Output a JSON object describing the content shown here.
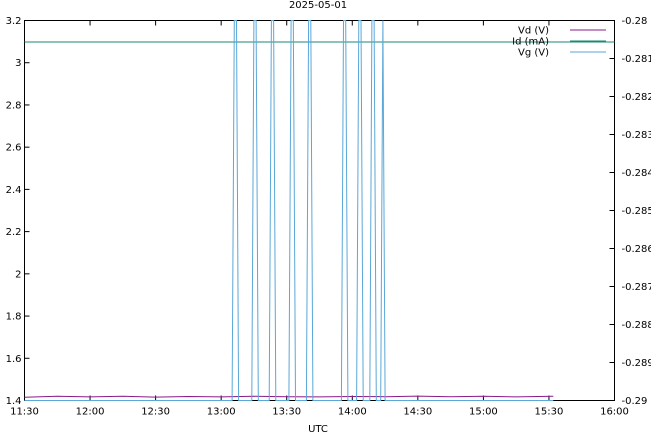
{
  "chart_data": {
    "type": "line",
    "title": "2025-05-01",
    "xlabel": "UTC",
    "ylabel": "",
    "y2label": "",
    "grid": false,
    "legend_position": "top-right",
    "x_ticks": [
      "11:30",
      "12:00",
      "12:30",
      "13:00",
      "13:30",
      "14:00",
      "14:30",
      "15:00",
      "15:30",
      "16:00"
    ],
    "xlim": [
      "11:30",
      "16:00"
    ],
    "ylim": [
      1.4,
      3.2
    ],
    "y_ticks": [
      "1.4",
      "1.6",
      "1.8",
      "2",
      "2.2",
      "2.4",
      "2.6",
      "2.8",
      "3",
      "3.2"
    ],
    "y2lim": [
      -0.29,
      -0.28
    ],
    "y2_ticks": [
      "-0.29",
      "-0.289",
      "-0.288",
      "-0.287",
      "-0.286",
      "-0.285",
      "-0.284",
      "-0.283",
      "-0.282",
      "-0.281",
      "-0.28"
    ],
    "series": [
      {
        "name": "Vd (V)",
        "axis": "left",
        "color": "#8b1a89",
        "x": [
          "11:30",
          "11:45",
          "12:00",
          "12:15",
          "12:30",
          "12:45",
          "13:00",
          "13:15",
          "13:30",
          "13:45",
          "14:00",
          "14:15",
          "14:30",
          "14:45",
          "15:00",
          "15:15",
          "15:32"
        ],
        "y": [
          1.415,
          1.42,
          1.417,
          1.42,
          1.416,
          1.419,
          1.417,
          1.42,
          1.418,
          1.417,
          1.419,
          1.418,
          1.421,
          1.418,
          1.42,
          1.417,
          1.42
        ]
      },
      {
        "name": "Id (mA)",
        "axis": "left",
        "color": "#1a8a76",
        "x": [
          "11:30",
          "16:00"
        ],
        "y": [
          3.098,
          3.098
        ]
      },
      {
        "name": "Vg (V)",
        "axis": "right",
        "color": "#5aa7d8",
        "x": [
          "11:30",
          "13:05",
          "13:06",
          "13:07",
          "13:08",
          "13:14",
          "13:15",
          "13:16",
          "13:17",
          "13:22",
          "13:23",
          "13:24",
          "13:25",
          "13:31",
          "13:32",
          "13:33",
          "13:34",
          "13:39",
          "13:40",
          "13:41",
          "13:42",
          "13:55",
          "13:56",
          "13:57",
          "13:58",
          "14:02",
          "14:03",
          "14:04",
          "14:05",
          "14:08",
          "14:09",
          "14:10",
          "14:11",
          "14:13",
          "14:14",
          "14:15",
          "15:32"
        ],
        "y": [
          -0.29,
          -0.29,
          -0.28,
          -0.28,
          -0.29,
          -0.29,
          -0.28,
          -0.28,
          -0.29,
          -0.29,
          -0.28,
          -0.28,
          -0.29,
          -0.29,
          -0.28,
          -0.28,
          -0.29,
          -0.29,
          -0.28,
          -0.28,
          -0.29,
          -0.29,
          -0.28,
          -0.28,
          -0.29,
          -0.29,
          -0.28,
          -0.28,
          -0.29,
          -0.29,
          -0.28,
          -0.28,
          -0.29,
          -0.29,
          -0.28,
          -0.29,
          -0.29
        ]
      }
    ]
  }
}
